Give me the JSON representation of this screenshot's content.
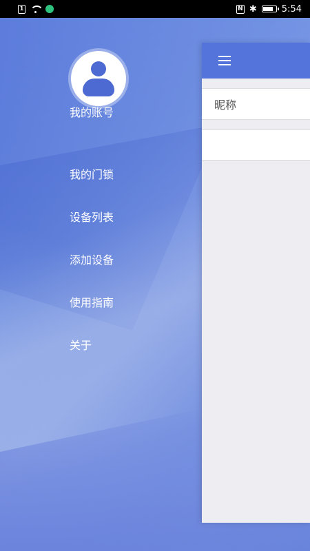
{
  "status_bar": {
    "sim_label": "1",
    "nfc_label": "N",
    "bluetooth_glyph": "✱",
    "battery_level": 0.85,
    "time": "5:54",
    "app_dot_color": "#2ec27e"
  },
  "drawer": {
    "account_label": "我的账号",
    "menu_items": [
      {
        "label": "我的门锁"
      },
      {
        "label": "设备列表"
      },
      {
        "label": "添加设备"
      },
      {
        "label": "使用指南"
      },
      {
        "label": "关于"
      }
    ]
  },
  "main": {
    "toolbar_color": "#5474db",
    "nickname_label": "昵称",
    "nickname_value": ""
  },
  "icons": {
    "menu": "hamburger-icon",
    "avatar": "user-avatar-icon"
  }
}
